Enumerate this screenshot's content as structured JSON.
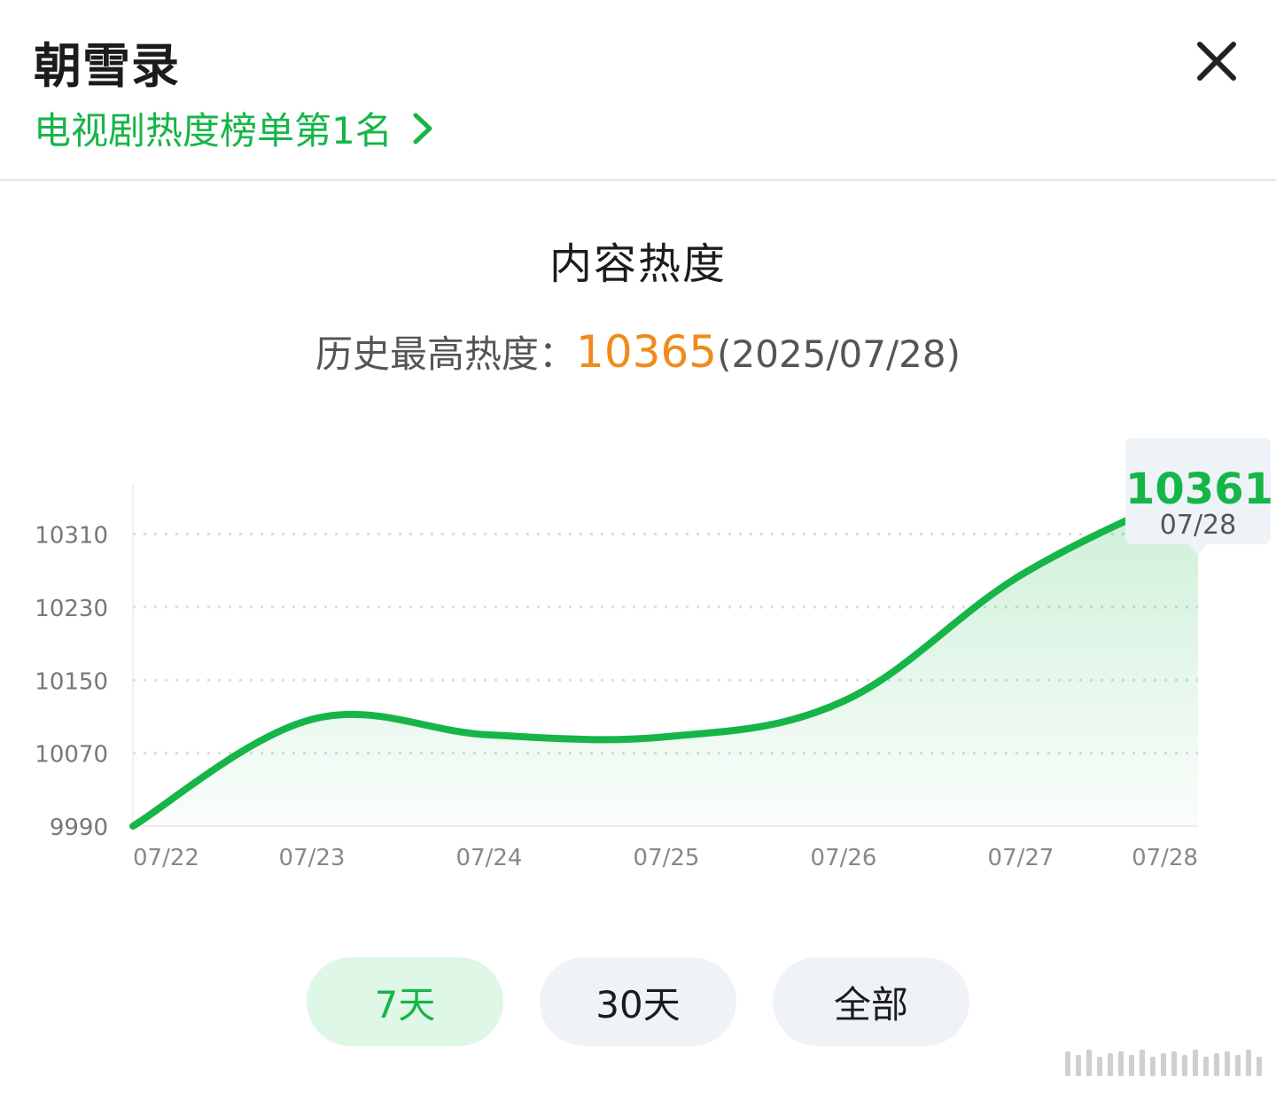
{
  "header": {
    "title": "朝雪录",
    "rank_text": "电视剧热度榜单第1名"
  },
  "section": {
    "title": "内容热度",
    "max_label": "历史最高热度：",
    "max_value": "10365",
    "max_date": "(2025/07/28)"
  },
  "tooltip": {
    "value": "10361",
    "date": "07/28"
  },
  "tabs": [
    {
      "label": "7天",
      "active": true
    },
    {
      "label": "30天",
      "active": false
    },
    {
      "label": "全部",
      "active": false
    }
  ],
  "colors": {
    "accent": "#16b548",
    "max_value": "#f08a1c",
    "tab_bg": "#eff3f8",
    "tab_active_bg": "#dff7e6"
  },
  "chart_data": {
    "type": "area",
    "x": [
      "07/22",
      "07/23",
      "07/24",
      "07/25",
      "07/26",
      "07/27",
      "07/28"
    ],
    "values": [
      9990,
      10107,
      10090,
      10088,
      10127,
      10265,
      10361
    ],
    "y_ticks": [
      9990,
      10070,
      10150,
      10230,
      10310
    ],
    "ylim": [
      9990,
      10361
    ],
    "grid": true,
    "highlight_index": 6
  }
}
